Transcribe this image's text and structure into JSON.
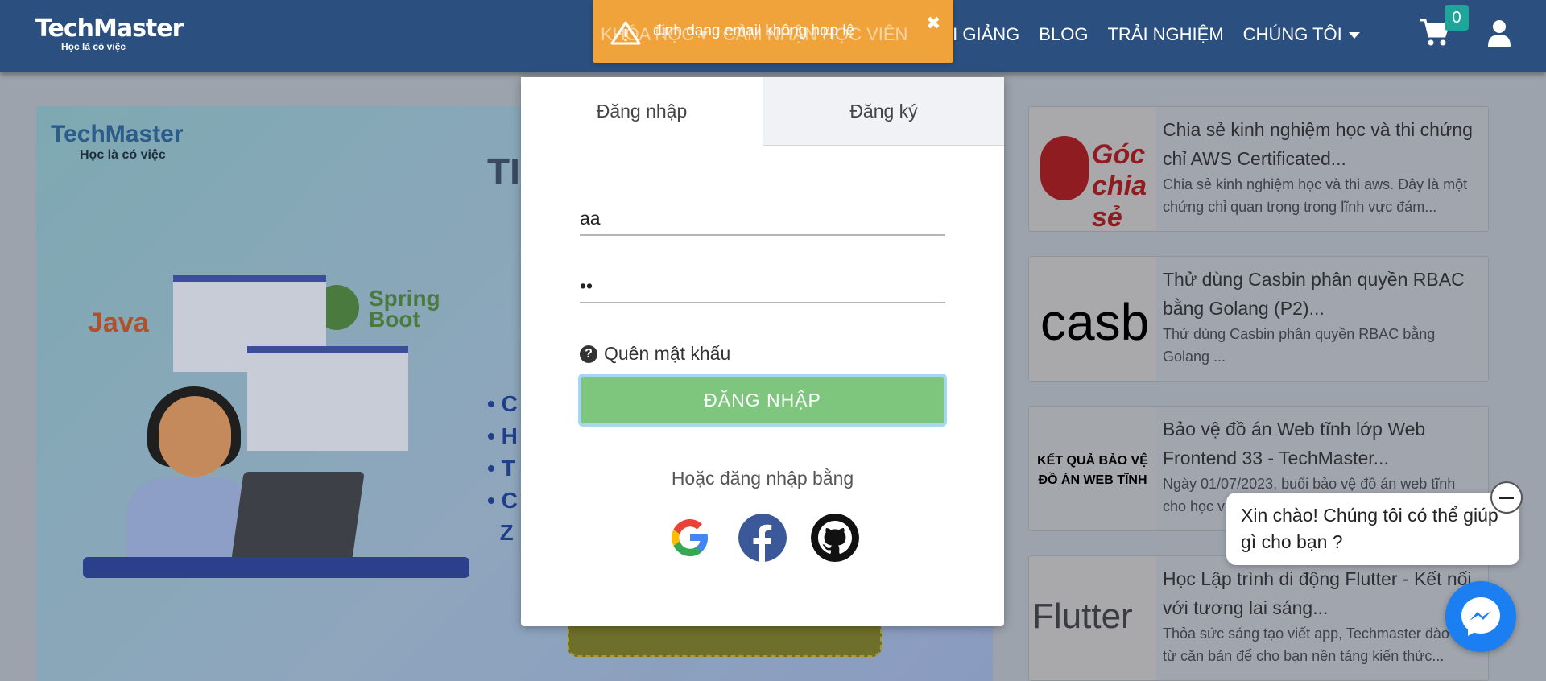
{
  "header": {
    "logo_title": "TechMaster",
    "logo_tagline": "Học là có việc",
    "nav": [
      "KHÓA HỌC",
      "CẢM NHẬN HỌC VIÊN",
      "KHAI GIẢNG",
      "BLOG",
      "TRẢI NGHIỆM",
      "CHÚNG TÔI"
    ],
    "cart_count": "0",
    "icons": [
      "cart-icon",
      "user-icon",
      "chevron-down-icon"
    ]
  },
  "toast": {
    "message": "định dạng email không hợp lệ",
    "close_symbol": "✖",
    "color": "#f0a33a"
  },
  "modal": {
    "tab_login": "Đăng nhập",
    "tab_register": "Đăng ký",
    "email_value": "aa",
    "password_value": "••",
    "forgot_password": "Quên mật khẩu",
    "help_symbol": "?",
    "login_button": "ĐĂNG NHẬP",
    "or_login_with": "Hoặc đăng nhập bằng",
    "social": [
      "google-icon",
      "facebook-icon",
      "github-icon"
    ],
    "button_color": "#7ec57e"
  },
  "banner": {
    "logo_title": "TechMaster",
    "logo_tagline": "Học là có việc",
    "java_label": "Java",
    "spring_label_1": "Spring",
    "spring_label_2": "Boot",
    "title_fragment": "TI",
    "bullets": [
      "C",
      "H",
      "T",
      "C",
      "Z"
    ]
  },
  "cards": [
    {
      "title": "Chia sẻ kinh nghiệm học và thi chứng chỉ AWS Certificated...",
      "desc": "Chia sẻ kinh nghiệm học và thi aws. Đây là một chứng chỉ quan trọng trong lĩnh vực đám...",
      "thumb_text": "Góc chia sẻ"
    },
    {
      "title": "Thử dùng Casbin phân quyền RBAC bằng Golang (P2)...",
      "desc": "Thử dùng Casbin phân quyền RBAC bằng Golang ...",
      "thumb_text": "casb"
    },
    {
      "title": "Bảo vệ đồ án Web tĩnh lớp Web Frontend 33 - TechMaster...",
      "desc": "Ngày 01/07/2023, buổi bảo vệ đồ án web tĩnh cho học viên...",
      "thumb_text": "KẾT QUẢ BẢO VỆ ĐỒ ÁN WEB TĨNH"
    },
    {
      "title": "Học Lập trình di động Flutter - Kết nối với tương lai sáng...",
      "desc": "Thỏa sức sáng tạo viết app, Techmaster đào tạo từ căn bản để cho bạn nền tảng kiến thức...",
      "thumb_text": "Flutter"
    }
  ],
  "chat": {
    "greeting": "Xin chào! Chúng tôi có thể giúp gì cho bạn ?"
  }
}
